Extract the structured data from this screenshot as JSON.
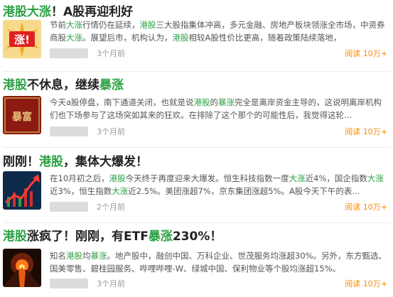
{
  "articles": [
    {
      "title": [
        {
          "text": "港股大涨",
          "highlight": true
        },
        {
          "text": "！A股再迎利好",
          "highlight": false
        }
      ],
      "summary": "节前大涨行情仍在延续，港股三大股指集体冲高，多元金融、房地产板块领涨全市场，中资券商股大涨。展望后市，机构认为，港股相较A股性价比更高，随着政策陆续落地，",
      "thumb_text": "涨!",
      "time": "3个月前",
      "reads": "阅读 10万+"
    },
    {
      "title": [
        {
          "text": "港股",
          "highlight": true
        },
        {
          "text": "不休息，继续",
          "highlight": false
        },
        {
          "text": "暴涨",
          "highlight": true
        }
      ],
      "summary": "今天a股停盘，南下通道关闭，也就是说港股的暴涨完全是离岸资金主导的，这说明离岸机构们也下场参与了这场突如其来的狂欢。在排除了这个那个的可能性后，我觉得这轮...",
      "thumb_text": "暴富",
      "time": "3个月前",
      "reads": "阅读 10万+"
    },
    {
      "title": [
        {
          "text": "刚刚！",
          "highlight": false
        },
        {
          "text": "港股",
          "highlight": true
        },
        {
          "text": "，集体大爆发！",
          "highlight": false
        }
      ],
      "summary": "在10月初之后，港股今天终于再度迎来大爆发。恒生科技指数一度大涨近4%，国企指数大涨近3%，恒生指数大涨近2.5%。美团涨超7%，京东集团涨超5%。A股今天下午的表...",
      "thumb_text": "",
      "time": "2个月前",
      "reads": "阅读 10万+"
    },
    {
      "title": [
        {
          "text": "港股",
          "highlight": true
        },
        {
          "text": "涨疯了！刚刚，有ETF",
          "highlight": false
        },
        {
          "text": "暴涨",
          "highlight": true
        },
        {
          "text": "230%！",
          "highlight": false
        }
      ],
      "summary": "知名港股均暴涨。地产股中，融创中国、万科企业、世茂服务均涨超30%。另外，东方甄选、国美零售、碧桂园服务、哔哩哔哩-W、绿城中国、保利物业等个股均涨超15%。",
      "thumb_text": "",
      "time": "3个月前",
      "reads": "阅读 10万+"
    }
  ],
  "colors": {
    "highlight": "#2aa143",
    "reads": "#ff8a00",
    "title": "#222222",
    "summary": "#555555",
    "time": "#999999"
  }
}
